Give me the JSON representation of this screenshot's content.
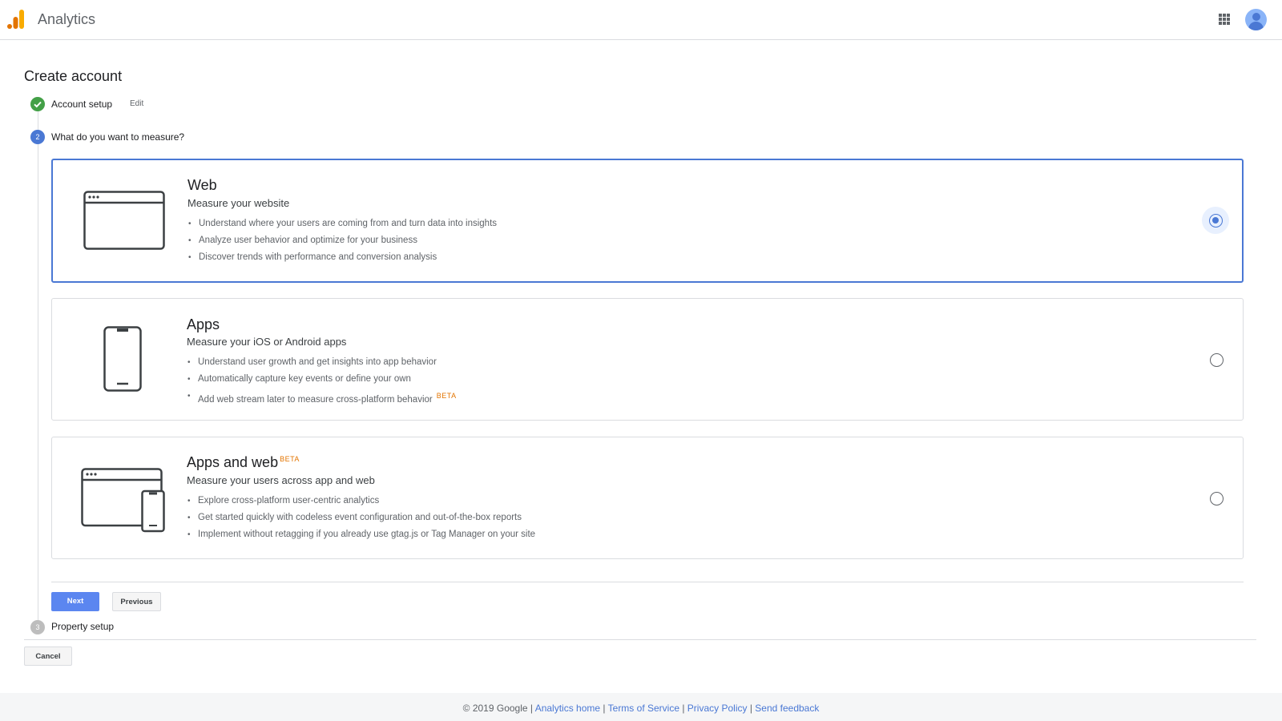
{
  "header": {
    "app_title": "Analytics"
  },
  "page": {
    "title": "Create account"
  },
  "steps": [
    {
      "number": "1",
      "label": "Account setup",
      "state": "completed",
      "edit_label": "Edit"
    },
    {
      "number": "2",
      "label": "What do you want to measure?",
      "state": "active"
    },
    {
      "number": "3",
      "label": "Property setup",
      "state": "pending"
    }
  ],
  "options": [
    {
      "title": "Web",
      "subtitle": "Measure your website",
      "bullets": [
        "Understand where your users are coming from and turn data into insights",
        "Analyze user behavior and optimize for your business",
        "Discover trends with performance and conversion analysis"
      ],
      "selected": true,
      "icon": "browser-window-icon"
    },
    {
      "title": "Apps",
      "subtitle": "Measure your iOS or Android apps",
      "bullets": [
        "Understand user growth and get insights into app behavior",
        "Automatically capture key events or define your own",
        "Add web stream later to measure cross-platform behavior"
      ],
      "bullet_badge": "BETA",
      "selected": false,
      "icon": "smartphone-icon"
    },
    {
      "title": "Apps and web",
      "title_badge": "BETA",
      "subtitle": "Measure your users across app and web",
      "bullets": [
        "Explore cross-platform user-centric analytics",
        "Get started quickly with codeless event configuration and out-of-the-box reports",
        "Implement without retagging if you already use gtag.js or Tag Manager on your site"
      ],
      "selected": false,
      "icon": "browser-and-phone-icon"
    }
  ],
  "buttons": {
    "next": "Next",
    "previous": "Previous",
    "cancel": "Cancel"
  },
  "footer": {
    "copyright": "© 2019 Google",
    "separator": " | ",
    "links": [
      "Analytics home",
      "Terms of Service",
      "Privacy Policy",
      "Send feedback"
    ]
  },
  "colors": {
    "accent": "#4a78d4",
    "primary_button": "#5b86f0",
    "success": "#43a047",
    "beta": "#e37400"
  }
}
